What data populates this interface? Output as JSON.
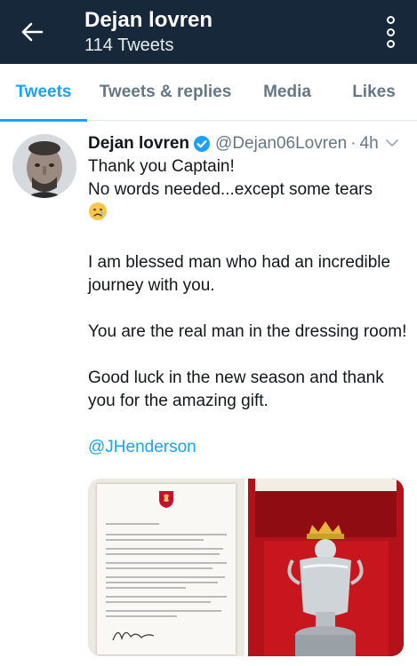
{
  "header": {
    "title": "Dejan lovren",
    "subtitle": "114 Tweets"
  },
  "tabs": [
    {
      "label": "Tweets",
      "active": true
    },
    {
      "label": "Tweets & replies",
      "active": false
    },
    {
      "label": "Media",
      "active": false
    },
    {
      "label": "Likes",
      "active": false
    }
  ],
  "tweet": {
    "name": "Dejan lovren",
    "handle": "@Dejan06Lovren",
    "separator": "·",
    "time": "4h",
    "lines": {
      "l1": "Thank you Captain!",
      "l2": "No words needed...except some tears",
      "l3": "I am blessed man who had an incredible journey with you.",
      "l4": "You are the real man in the dressing room!",
      "l5": "Good luck in the new season and thank you for the amazing gift."
    },
    "mention": "@JHenderson",
    "emoji": "crying-face-emoji"
  },
  "colors": {
    "header_bg": "#17283a",
    "accent": "#1da1f2",
    "muted": "#657786",
    "text": "#14171a"
  }
}
